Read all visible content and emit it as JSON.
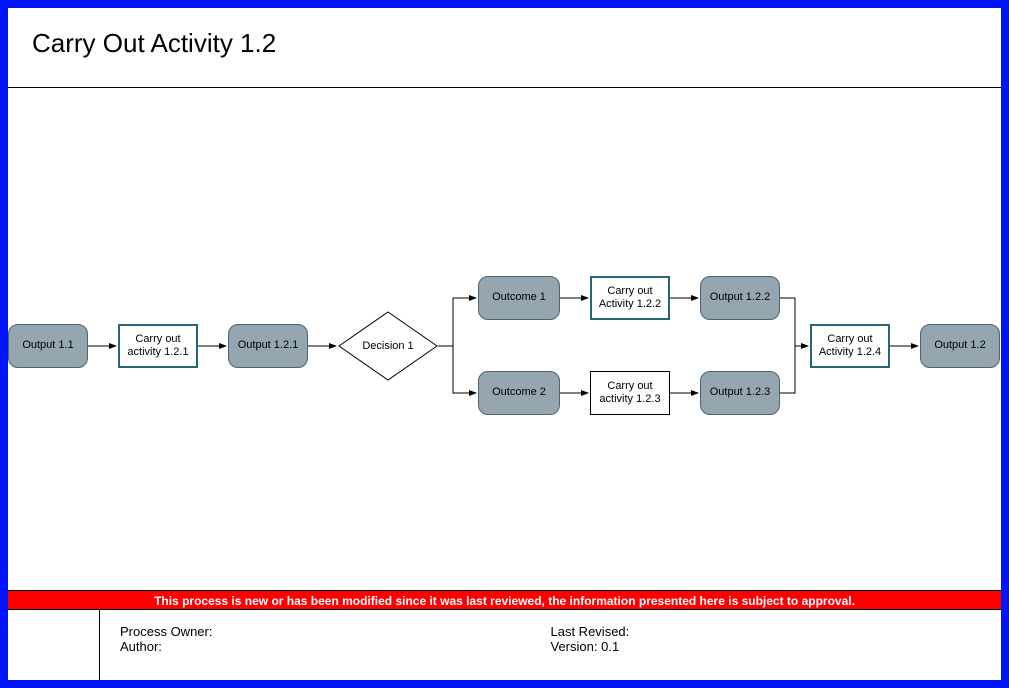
{
  "title": "Carry Out Activity 1.2",
  "nodes": {
    "output_1_1": "Output 1.1",
    "activity_1_2_1": "Carry out activity 1.2.1",
    "output_1_2_1": "Output 1.2.1",
    "decision_1": "Decision 1",
    "outcome_1": "Outcome 1",
    "outcome_2": "Outcome 2",
    "activity_1_2_2": "Carry out Activity 1.2.2",
    "activity_1_2_3": "Carry out activity 1.2.3",
    "output_1_2_2": "Output 1.2.2",
    "output_1_2_3": "Output 1.2.3",
    "activity_1_2_4": "Carry out Activity 1.2.4",
    "output_1_2": "Output 1.2"
  },
  "banner": "This process is new or has been modified since it was last reviewed, the information presented here is subject to approval.",
  "footer": {
    "process_owner_label": "Process Owner:",
    "process_owner_value": "",
    "author_label": "Author:",
    "author_value": "",
    "last_revised_label": "Last Revised:",
    "last_revised_value": "",
    "version_label": "Version:",
    "version_value": "0.1"
  },
  "chart_data": {
    "type": "flowchart",
    "title": "Carry Out Activity 1.2",
    "nodes": [
      {
        "id": "output_1_1",
        "label": "Output 1.1",
        "kind": "terminator"
      },
      {
        "id": "activity_1_2_1",
        "label": "Carry out activity 1.2.1",
        "kind": "process-highlight"
      },
      {
        "id": "output_1_2_1",
        "label": "Output 1.2.1",
        "kind": "terminator"
      },
      {
        "id": "decision_1",
        "label": "Decision 1",
        "kind": "decision"
      },
      {
        "id": "outcome_1",
        "label": "Outcome 1",
        "kind": "terminator"
      },
      {
        "id": "outcome_2",
        "label": "Outcome 2",
        "kind": "terminator"
      },
      {
        "id": "activity_1_2_2",
        "label": "Carry out Activity 1.2.2",
        "kind": "process-highlight"
      },
      {
        "id": "activity_1_2_3",
        "label": "Carry out activity 1.2.3",
        "kind": "process"
      },
      {
        "id": "output_1_2_2",
        "label": "Output 1.2.2",
        "kind": "terminator"
      },
      {
        "id": "output_1_2_3",
        "label": "Output 1.2.3",
        "kind": "terminator"
      },
      {
        "id": "activity_1_2_4",
        "label": "Carry out Activity 1.2.4",
        "kind": "process-highlight"
      },
      {
        "id": "output_1_2",
        "label": "Output 1.2",
        "kind": "terminator"
      }
    ],
    "edges": [
      {
        "from": "output_1_1",
        "to": "activity_1_2_1"
      },
      {
        "from": "activity_1_2_1",
        "to": "output_1_2_1"
      },
      {
        "from": "output_1_2_1",
        "to": "decision_1"
      },
      {
        "from": "decision_1",
        "to": "outcome_1"
      },
      {
        "from": "decision_1",
        "to": "outcome_2"
      },
      {
        "from": "outcome_1",
        "to": "activity_1_2_2"
      },
      {
        "from": "outcome_2",
        "to": "activity_1_2_3"
      },
      {
        "from": "activity_1_2_2",
        "to": "output_1_2_2"
      },
      {
        "from": "activity_1_2_3",
        "to": "output_1_2_3"
      },
      {
        "from": "output_1_2_2",
        "to": "activity_1_2_4"
      },
      {
        "from": "output_1_2_3",
        "to": "activity_1_2_4"
      },
      {
        "from": "activity_1_2_4",
        "to": "output_1_2"
      }
    ]
  }
}
